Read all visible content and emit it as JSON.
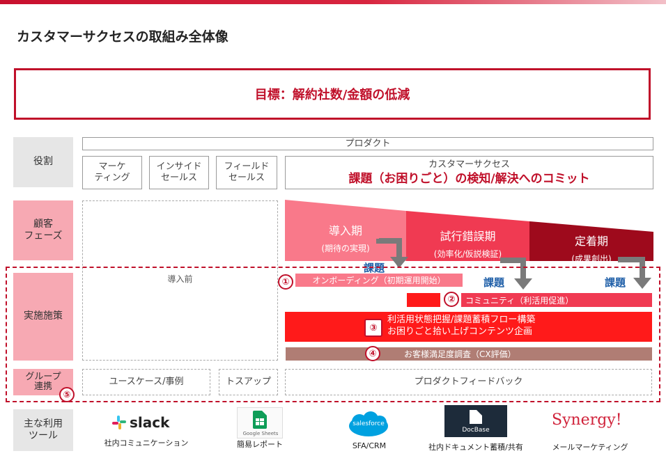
{
  "title": "カスタマーサクセスの取組み全体像",
  "goal": "目標：解約社数/金額の低減",
  "row_labels": {
    "role": "役割",
    "customer_phase": "顧客\nフェーズ",
    "measures": "実施施策",
    "group": "グループ\n連携",
    "tools": "主な利用\nツール"
  },
  "roles": {
    "product": "プロダクト",
    "marketing": "マーケ\nティング",
    "inside_sales": "インサイド\nセールス",
    "field_sales": "フィールド\nセールス",
    "cs_title": "カスタマーサクセス",
    "cs_mission": "課題（お困りごと）の検知/解決へのコミット"
  },
  "pre_intro": "導入前",
  "phases": [
    {
      "name": "導入期",
      "sub": "(期待の実現)"
    },
    {
      "name": "試行錯誤期",
      "sub": "(効率化/仮説検証)"
    },
    {
      "name": "定着期",
      "sub": "(成果創出)"
    }
  ],
  "issue_label": "課題",
  "measures": [
    {
      "num": "①",
      "text": "オンボーディング（初期運用開始）"
    },
    {
      "num": "②",
      "text": "コミュニティ（利活用促進）"
    },
    {
      "num": "③",
      "text": "利活用状態把握/課題蓄積フロー構築\nお困りごと拾い上げコンテンツ企画"
    },
    {
      "num": "④",
      "text": "お客様満足度調査（CX評価）"
    },
    {
      "num": "⑤",
      "text": ""
    }
  ],
  "group": {
    "use_case": "ユースケース/事例",
    "toss_up": "トスアップ",
    "feedback": "プロダクトフィードバック"
  },
  "tools": [
    {
      "logo": "slack",
      "caption": "社内コミュニケーション"
    },
    {
      "logo": "Google Sheets",
      "caption": "簡易レポート"
    },
    {
      "logo": "salesforce",
      "caption": "SFA/CRM"
    },
    {
      "logo": "DocBase",
      "caption": "社内ドキュメント蓄積/共有"
    },
    {
      "logo": "Synergy!",
      "caption": "メールマーケティング"
    }
  ],
  "colors": {
    "red": "#c0102a",
    "phase1": "#f9798a",
    "phase2": "#f03a52",
    "phase3": "#9e0a1c",
    "bar_red": "#ff1a1a",
    "bar_brown": "#b07d74",
    "issue_blue": "#1f5fa8"
  }
}
